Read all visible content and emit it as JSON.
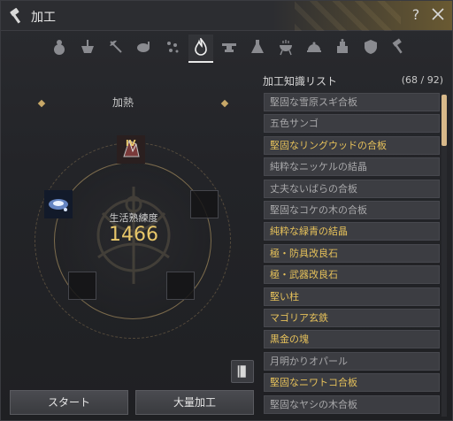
{
  "window": {
    "title": "加工",
    "help": "?"
  },
  "icons": {
    "title": "hammer-icon",
    "close": "close-icon",
    "tabs": [
      "gourd-icon",
      "mortar-icon",
      "axe-icon",
      "meat-icon",
      "sparkle-icon",
      "fire-icon",
      "anvil-icon",
      "flask-icon",
      "grill-icon",
      "cloche-icon",
      "cake-icon",
      "shield-icon",
      "hammer-icon"
    ]
  },
  "colors": {
    "accent_gold": "#e6c15a",
    "item_gray": "#a8a8aa",
    "scroll_thumb": "#d8b98a"
  },
  "active_tab": 5,
  "left": {
    "heat_label": "加熱",
    "mastery_label": "生活熟練度",
    "mastery_value": "1466",
    "slot_badge": "IV",
    "buttons": {
      "start": "スタート",
      "mass": "大量加工"
    }
  },
  "right": {
    "header": "加工知識リスト",
    "count": "(68 / 92)",
    "items": [
      {
        "label": "堅固な雪原スギ合板",
        "style": "gray"
      },
      {
        "label": "五色サンゴ",
        "style": "gray"
      },
      {
        "label": "堅固なリングウッドの合板",
        "style": "gold"
      },
      {
        "label": "純粋なニッケルの結晶",
        "style": "gray"
      },
      {
        "label": "丈夫ないばらの合板",
        "style": "gray"
      },
      {
        "label": "堅固なコケの木の合板",
        "style": "gray"
      },
      {
        "label": "純粋な緑青の結晶",
        "style": "gold"
      },
      {
        "label": "極・防具改良石",
        "style": "gold"
      },
      {
        "label": "極・武器改良石",
        "style": "gold"
      },
      {
        "label": "堅い柱",
        "style": "gold"
      },
      {
        "label": "マゴリア玄鉄",
        "style": "gold"
      },
      {
        "label": "黒金の塊",
        "style": "gold"
      },
      {
        "label": "月明かりオパール",
        "style": "gray"
      },
      {
        "label": "堅固なニワトコ合板",
        "style": "gold"
      },
      {
        "label": "堅固なヤシの木合板",
        "style": "gray"
      }
    ]
  }
}
